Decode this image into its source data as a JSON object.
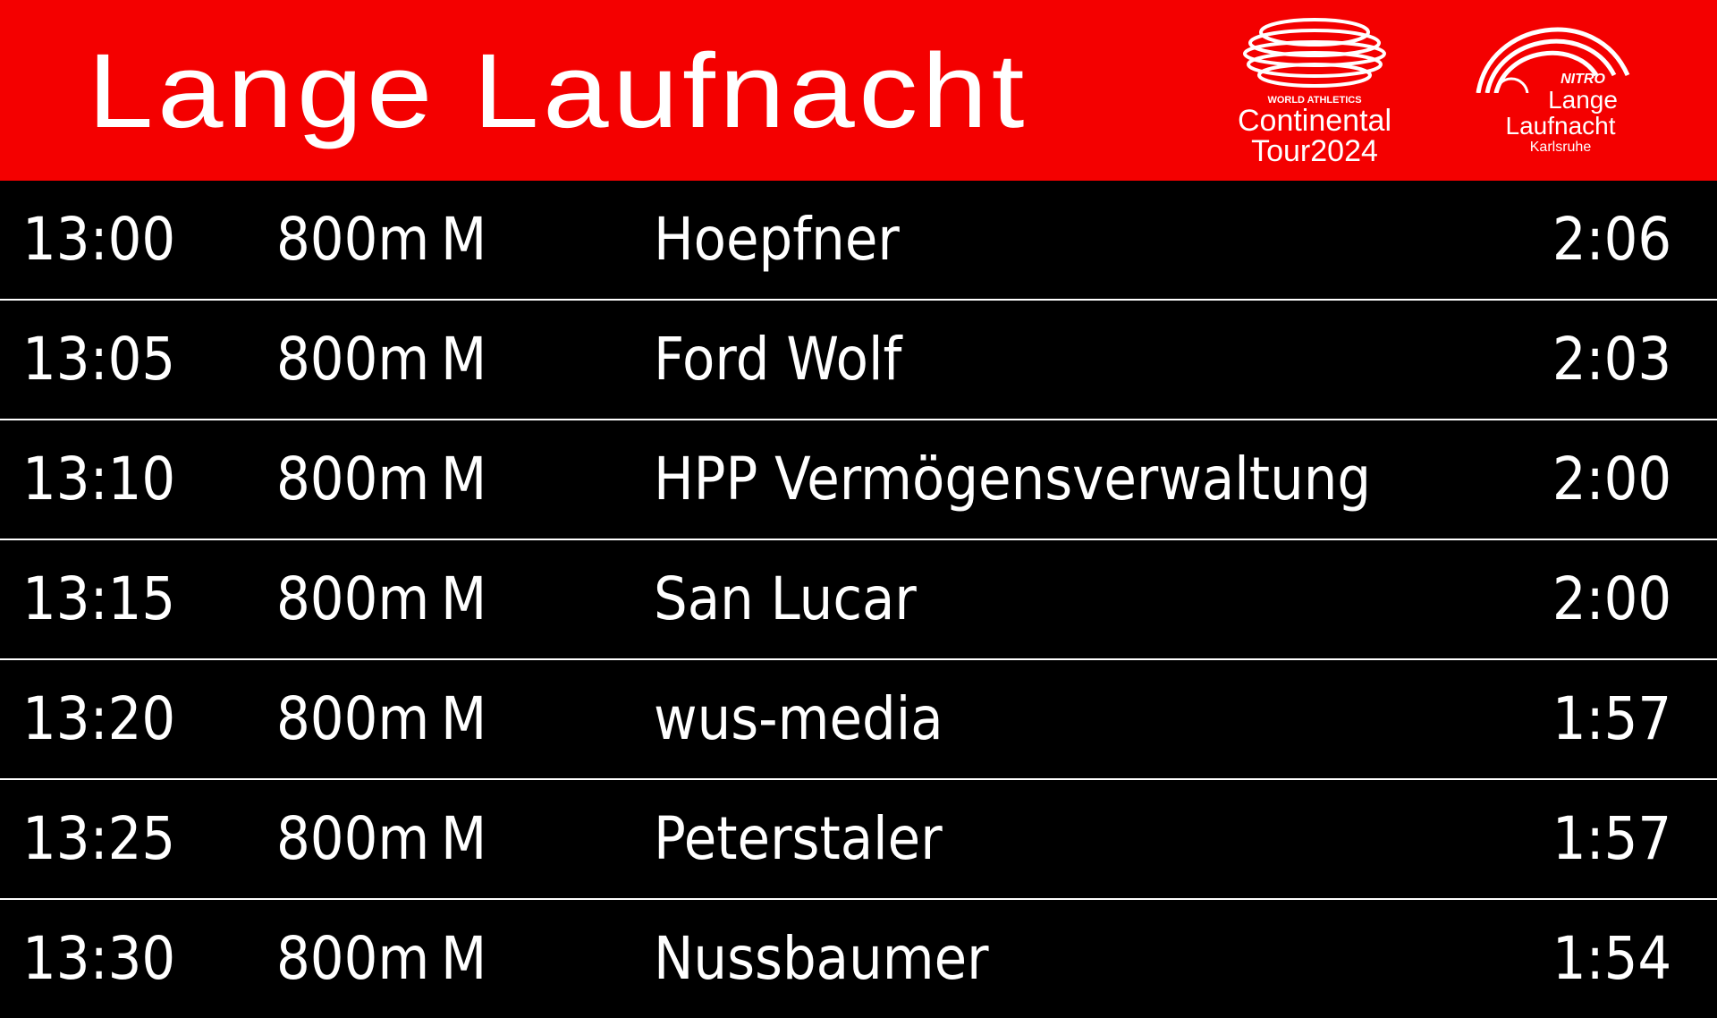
{
  "header": {
    "title": "Lange Laufnacht",
    "logo_tour": {
      "org": "WORLD ATHLETICS",
      "line1": "Continental",
      "line2": "Tour",
      "year": "2024"
    },
    "logo_event": {
      "brand": "NITRO",
      "line1": "Lange",
      "line2": "Laufnacht",
      "city": "Karlsruhe"
    },
    "accent_color": "#f40000"
  },
  "rows": [
    {
      "time": "13:00",
      "distance": "800m",
      "category": "M",
      "name": "Hoepfner",
      "result": "2:06"
    },
    {
      "time": "13:05",
      "distance": "800m",
      "category": "M",
      "name": "Ford Wolf",
      "result": "2:03"
    },
    {
      "time": "13:10",
      "distance": "800m",
      "category": "M",
      "name": "HPP Vermögensverwaltung",
      "result": "2:00"
    },
    {
      "time": "13:15",
      "distance": "800m",
      "category": "M",
      "name": "San Lucar",
      "result": "2:00"
    },
    {
      "time": "13:20",
      "distance": "800m",
      "category": "M",
      "name": "wus-media",
      "result": "1:57"
    },
    {
      "time": "13:25",
      "distance": "800m",
      "category": "M",
      "name": "Peterstaler",
      "result": "1:57"
    },
    {
      "time": "13:30",
      "distance": "800m",
      "category": "M",
      "name": "Nussbaumer",
      "result": "1:54"
    }
  ]
}
